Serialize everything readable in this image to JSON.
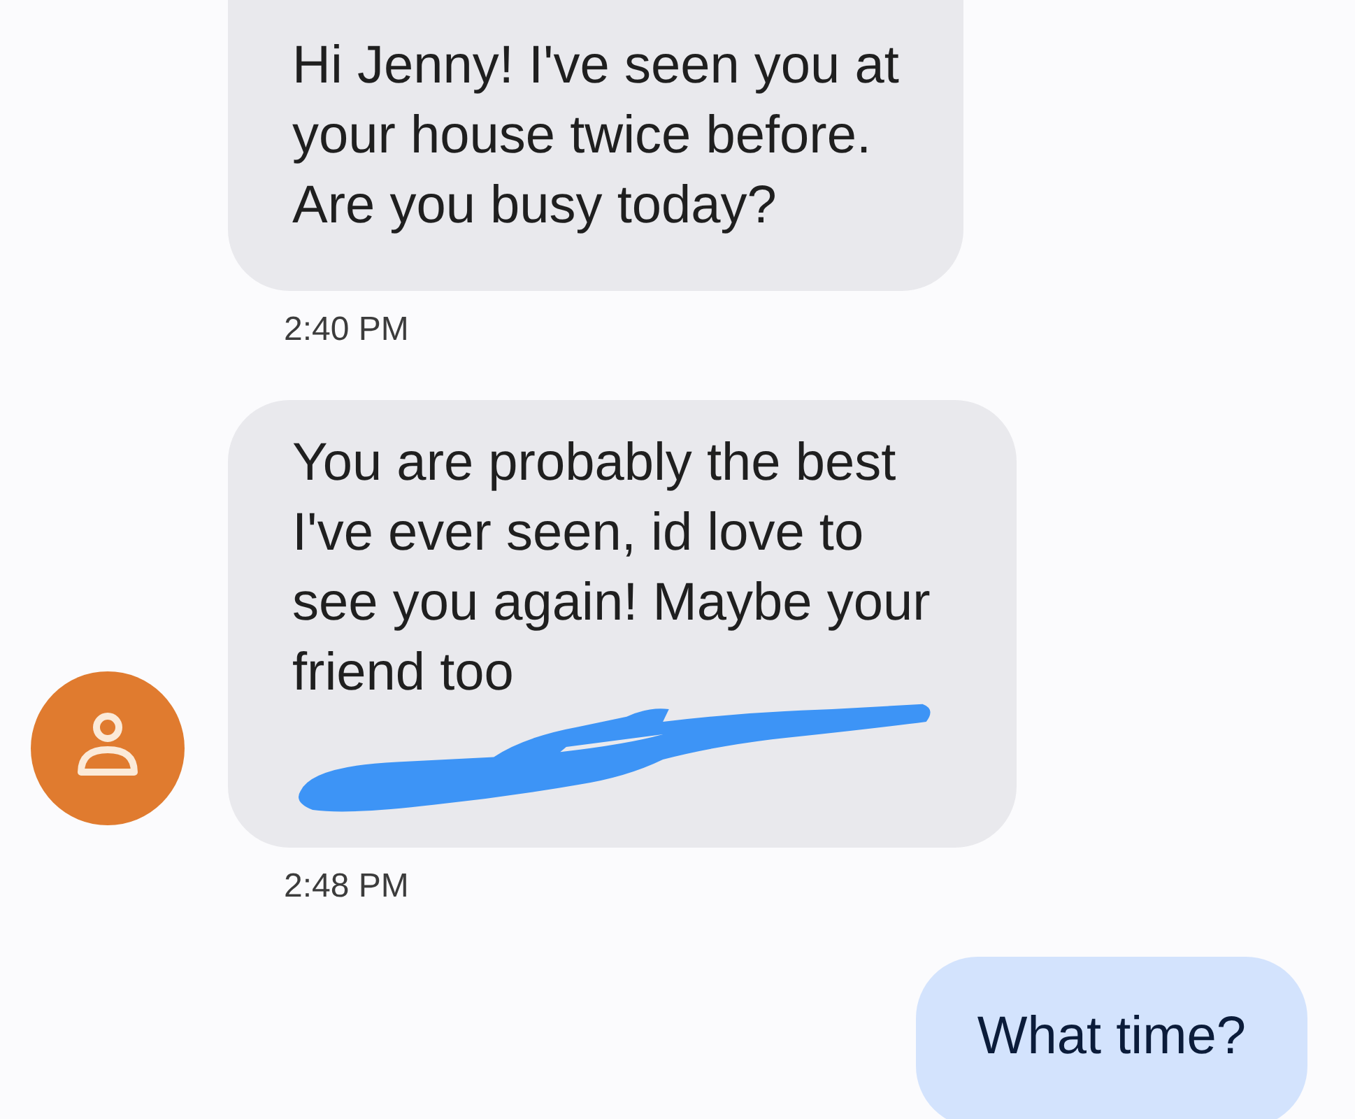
{
  "messages": [
    {
      "kind": "incoming",
      "avatar": false,
      "redacted": false,
      "text": "Hi Jenny! I've seen you at\nyour house twice before.\nAre you busy today?",
      "time": "2:40 PM"
    },
    {
      "kind": "incoming",
      "avatar": true,
      "redacted": true,
      "text": "You are probably the best\nI've ever seen, id love to\nsee you again! Maybe your\nfriend too",
      "time": "2:48 PM"
    },
    {
      "kind": "outgoing",
      "avatar": false,
      "redacted": false,
      "text": "What time?"
    }
  ]
}
